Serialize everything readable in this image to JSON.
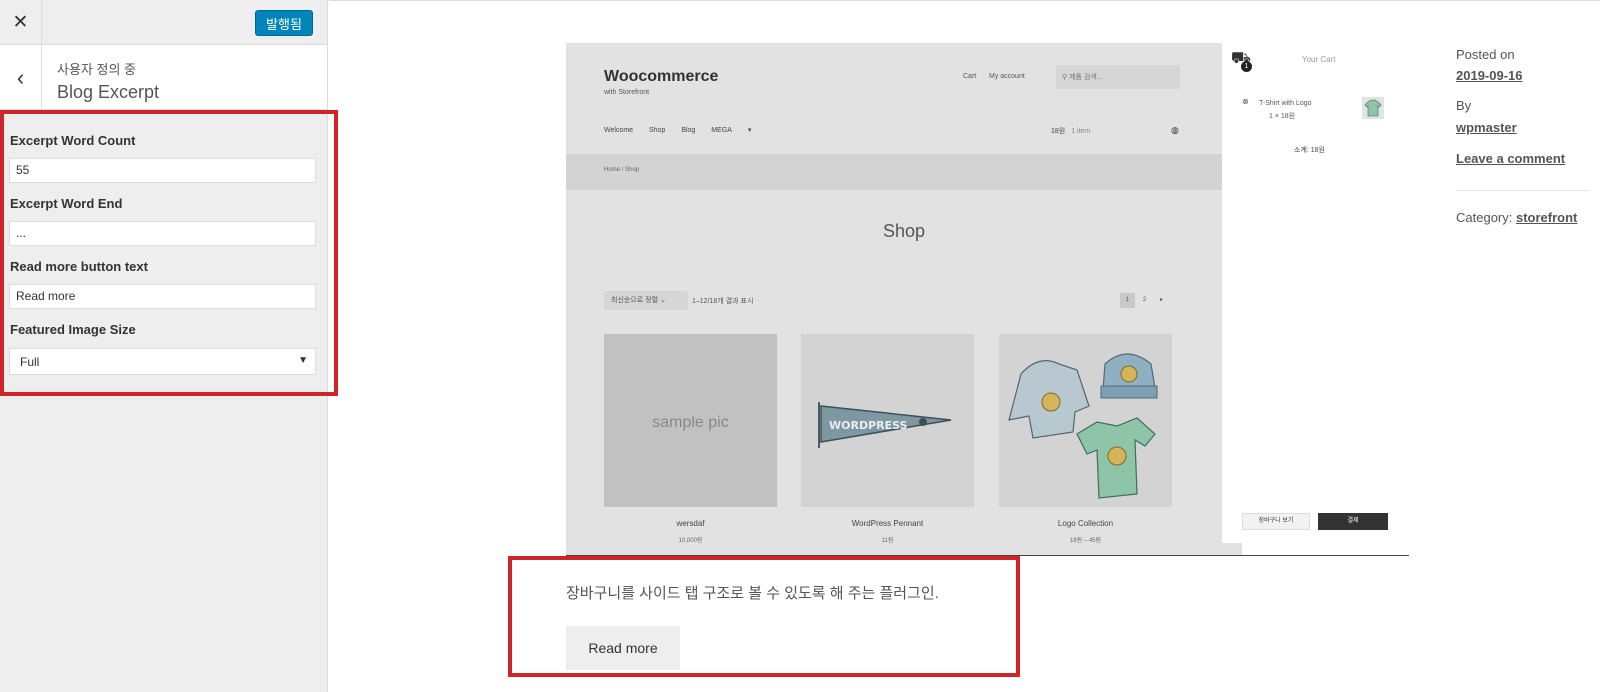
{
  "customizer": {
    "close_icon": "close-icon",
    "publish_label": "발행됨",
    "back_icon": "chevron-left-icon",
    "section_subtitle": "사용자 정의 중",
    "section_title": "Blog Excerpt",
    "controls": {
      "word_count_label": "Excerpt Word Count",
      "word_count_value": "55",
      "word_end_label": "Excerpt Word End",
      "word_end_value": "...",
      "read_more_label": "Read more button text",
      "read_more_value": "Read more",
      "image_size_label": "Featured Image Size",
      "image_size_value": "Full"
    },
    "accent_color": "#0085ba",
    "highlight_color": "#d0242b"
  },
  "post_image": {
    "site_title": "Woocommerce",
    "site_tagline": "with Storefront",
    "header_links": [
      "Cart",
      "My account"
    ],
    "search_placeholder": "제품 검색...",
    "nav_items": [
      "Welcome",
      "Shop",
      "Blog",
      "MEGA"
    ],
    "cart_total": "18원",
    "cart_count": "1 item",
    "breadcrumb": "Home / Shop",
    "page_title": "Shop",
    "sort_label": "최신순으로 정렬",
    "result_count": "1–12/18개 결과 표시",
    "pages": [
      "1",
      "2",
      "▸"
    ],
    "products": [
      {
        "name": "wersdaf",
        "price": "10,000원",
        "image_text": "sample pic"
      },
      {
        "name": "WordPress Pennant",
        "price": "11원"
      },
      {
        "name": "Logo Collection",
        "price": "18원 – 45원"
      }
    ],
    "side_cart": {
      "badge": "1",
      "title": "Your Cart",
      "item_name": "T-Shirt with Logo",
      "item_qty": "1 × 18원",
      "subtotal": "소계: 18원",
      "view_cart": "장바구니 보기",
      "checkout": "결제"
    }
  },
  "post_meta": {
    "posted_on_label": "Posted on",
    "date": "2019-09-16",
    "by_label": "By",
    "author": "wpmaster",
    "comment_link": "Leave a comment",
    "category_label": "Category: ",
    "category": "storefront"
  },
  "excerpt": {
    "text": "장바구니를 사이드 탭 구조로 볼 수 있도록 해 주는 플러그인.",
    "read_more": "Read more"
  }
}
